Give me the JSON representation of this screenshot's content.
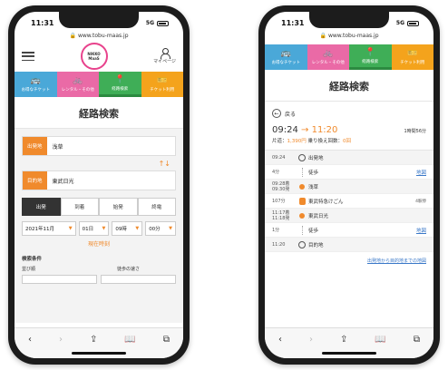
{
  "status": {
    "time": "11:31",
    "signal": "5G"
  },
  "left": {
    "url": "www.tobu-maas.jp",
    "logo_text": [
      "NIKKO",
      "MaaS"
    ],
    "mypage_label": "マイページ",
    "tabs": [
      {
        "label": "お得なチケット",
        "icon": "🚌"
      },
      {
        "label": "レンタル・その他",
        "icon": "🚲"
      },
      {
        "label": "経路検索",
        "icon": "📍"
      },
      {
        "label": "チケット利用",
        "icon": "🎫"
      }
    ],
    "title": "経路検索",
    "from_tag": "出発地",
    "from_value": "浅草",
    "to_tag": "目的地",
    "to_value": "東武日光",
    "swap_icon": "↑↓",
    "modes": [
      "出発",
      "到着",
      "始発",
      "終電"
    ],
    "date_selects": [
      "2021年11月",
      "01日",
      "09時",
      "00分"
    ],
    "now_label": "現在時刻",
    "conditions_label": "検索条件",
    "cond_left": "並び順",
    "cond_right": "徒歩の速さ"
  },
  "right": {
    "url": "www.tobu-maas.jp",
    "tabs": [
      {
        "label": "お得なチケット",
        "icon": "🚌"
      },
      {
        "label": "レンタル・その他",
        "icon": "🚲"
      },
      {
        "label": "経路検索",
        "icon": "📍"
      },
      {
        "label": "チケット利用",
        "icon": "🎫"
      }
    ],
    "title": "経路検索",
    "back_label": "戻る",
    "depart_time": "09:24",
    "arrive_time": "11:20",
    "duration": "1時間56分",
    "fare_text": "片道：",
    "fare_value": "1,390円",
    "transfer_text": "乗り換え回数：",
    "transfer_value": "0回",
    "steps": [
      {
        "time": "09:24",
        "label": "出発地",
        "kind": "pin",
        "gray": true
      },
      {
        "time": "4分",
        "label": "徒歩",
        "kind": "walk",
        "link": "地図"
      },
      {
        "time": "09:28着\n09:30発",
        "label": "浅草",
        "kind": "dot",
        "gray": true
      },
      {
        "time": "107分",
        "label": "東武特急けごん",
        "kind": "bus",
        "note": "4駅停"
      },
      {
        "time": "11:17着\n11:18発",
        "label": "東武日光",
        "kind": "dot",
        "gray": true
      },
      {
        "time": "1分",
        "label": "徒歩",
        "kind": "walk",
        "link": "地図"
      },
      {
        "time": "11:20",
        "label": "目的地",
        "kind": "pin",
        "gray": true
      }
    ],
    "map_link": "出発地から目的地までの地図"
  },
  "toolbar_icons": [
    "‹",
    "›",
    "⇪",
    "⧉",
    "⧉"
  ]
}
